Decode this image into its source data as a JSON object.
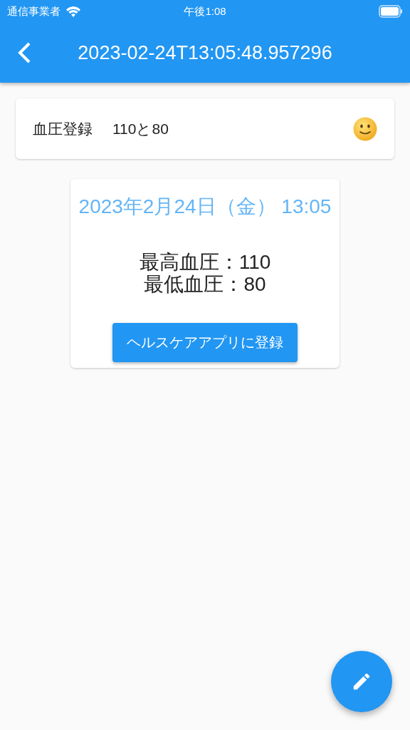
{
  "status_bar": {
    "carrier": "通信事業者",
    "time": "午後1:08"
  },
  "app_bar": {
    "title": "2023-02-24T13:05:48.957296"
  },
  "entry": {
    "label": "血圧登録",
    "value": "110と80"
  },
  "record": {
    "date": "2023年2月24日（金） 13:05",
    "lines": [
      "最高血圧：110",
      "最低血圧：80"
    ],
    "button": "ヘルスケアアプリに登録"
  }
}
